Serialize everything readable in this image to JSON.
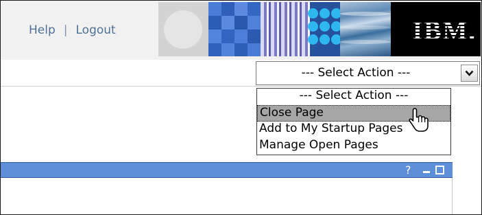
{
  "header": {
    "links": {
      "help": "Help",
      "separator": "|",
      "logout": "Logout"
    },
    "logo_text": "IBM."
  },
  "action_select": {
    "selected": "--- Select Action ---",
    "icons": {
      "open": "chevron-down-icon"
    },
    "options": [
      "--- Select Action ---",
      "Close Page",
      "Add to My Startup Pages",
      "Manage Open Pages"
    ],
    "highlighted_option": "Close Page"
  },
  "portlet": {
    "help_glyph": "?",
    "icons": {
      "help": "help-icon",
      "minimize": "minimize-icon",
      "maximize": "maximize-icon"
    }
  },
  "colors": {
    "link": "#4f6f97",
    "portlet_bar": "#5f8ed8",
    "highlight": "#a6a6a6"
  }
}
